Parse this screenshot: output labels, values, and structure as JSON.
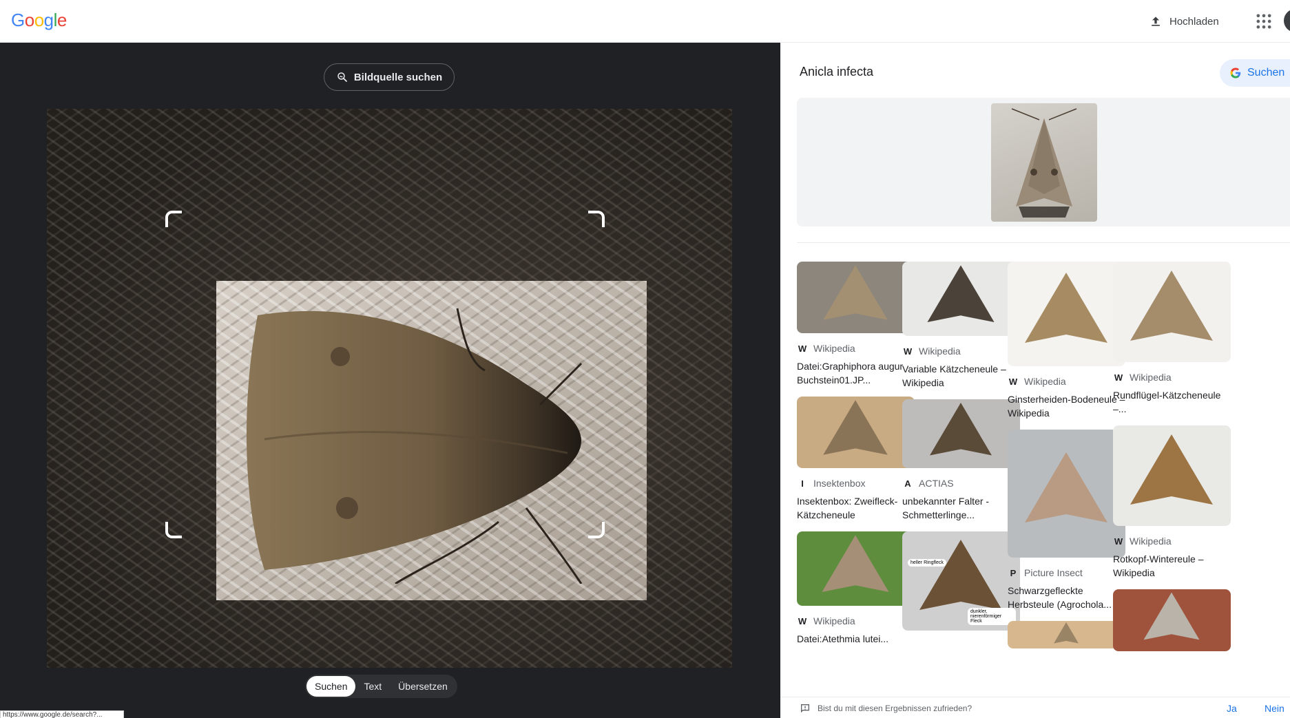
{
  "header": {
    "logo_letters": [
      {
        "ch": "G",
        "color": "#4285F4"
      },
      {
        "ch": "o",
        "color": "#EA4335"
      },
      {
        "ch": "o",
        "color": "#FBBC05"
      },
      {
        "ch": "g",
        "color": "#4285F4"
      },
      {
        "ch": "l",
        "color": "#34A853"
      },
      {
        "ch": "e",
        "color": "#EA4335"
      }
    ],
    "upload_label": "Hochladen",
    "upload_icon": "upload-icon",
    "apps_icon": "apps-grid-icon"
  },
  "left": {
    "source_button": "Bildquelle suchen",
    "modes": [
      {
        "label": "Suchen",
        "active": true
      },
      {
        "label": "Text",
        "active": false
      },
      {
        "label": "Übersetzen",
        "active": false
      }
    ]
  },
  "status_url": "https://www.google.de/search?...",
  "results": {
    "title": "Anicla infecta",
    "search_button": "Suchen",
    "columns": [
      [
        {
          "source": "Wikipedia",
          "source_icon": "W",
          "title": "Datei:Graphiphora augur Buchstein01.JP...",
          "bg": "#8c867d",
          "moth": "#a38f72"
        },
        {
          "source": "Insektenbox",
          "source_icon": "I",
          "title": "Insektenbox: Zweifleck-Kätzcheneule",
          "bg": "#c9ab83",
          "moth": "#8a7458"
        },
        {
          "source": "Wikipedia",
          "source_icon": "W",
          "title": "Datei:Atethmia lutei...",
          "bg": "#5e8d3d",
          "moth": "#a59077"
        }
      ],
      [
        {
          "source": "Wikipedia",
          "source_icon": "W",
          "title": "Variable Kätzcheneule – Wikipedia",
          "bg": "#e8e8e6",
          "moth": "#4b433a"
        },
        {
          "source": "ACTIAS",
          "source_icon": "A",
          "title": "unbekannter Falter - Schmetterlinge...",
          "bg": "#bdbcbb",
          "moth": "#5a4a38"
        },
        {
          "source": "",
          "source_icon": "",
          "title": "",
          "bg": "#cfcfcf",
          "moth": "#6b5237"
        }
      ],
      [
        {
          "source": "Wikipedia",
          "source_icon": "W",
          "title": "Ginsterheiden-Bodeneule – Wikipedia",
          "bg": "#f4f3f0",
          "moth": "#a78c63"
        },
        {
          "source": "Picture Insect",
          "source_icon": "P",
          "title": "Schwarzgefleckte Herbsteule (Agrochola...",
          "bg": "#b9bcbf",
          "moth": "#b99a82"
        },
        {
          "source": "",
          "source_icon": "",
          "title": "",
          "bg": "#d6b78e",
          "moth": "#9a8466"
        }
      ],
      [
        {
          "source": "Wikipedia",
          "source_icon": "W",
          "title": "Rundflügel-Kätzcheneule –...",
          "bg": "#f2f1ee",
          "moth": "#a58d6b"
        },
        {
          "source": "Wikipedia",
          "source_icon": "W",
          "title": "Rotkopf-Wintereule – Wikipedia",
          "bg": "#e9e9e6",
          "moth": "#9d7443"
        },
        {
          "source": "",
          "source_icon": "",
          "title": "",
          "bg": "#a0533c",
          "moth": "#b9b3aa"
        }
      ]
    ],
    "callout_labels": [
      "heller Ringfleck",
      "dunkler, nierenförmiger Fleck"
    ]
  },
  "feedback": {
    "question": "Bist du mit diesen Ergebnissen zufrieden?",
    "yes": "Ja",
    "no": "Nein"
  }
}
